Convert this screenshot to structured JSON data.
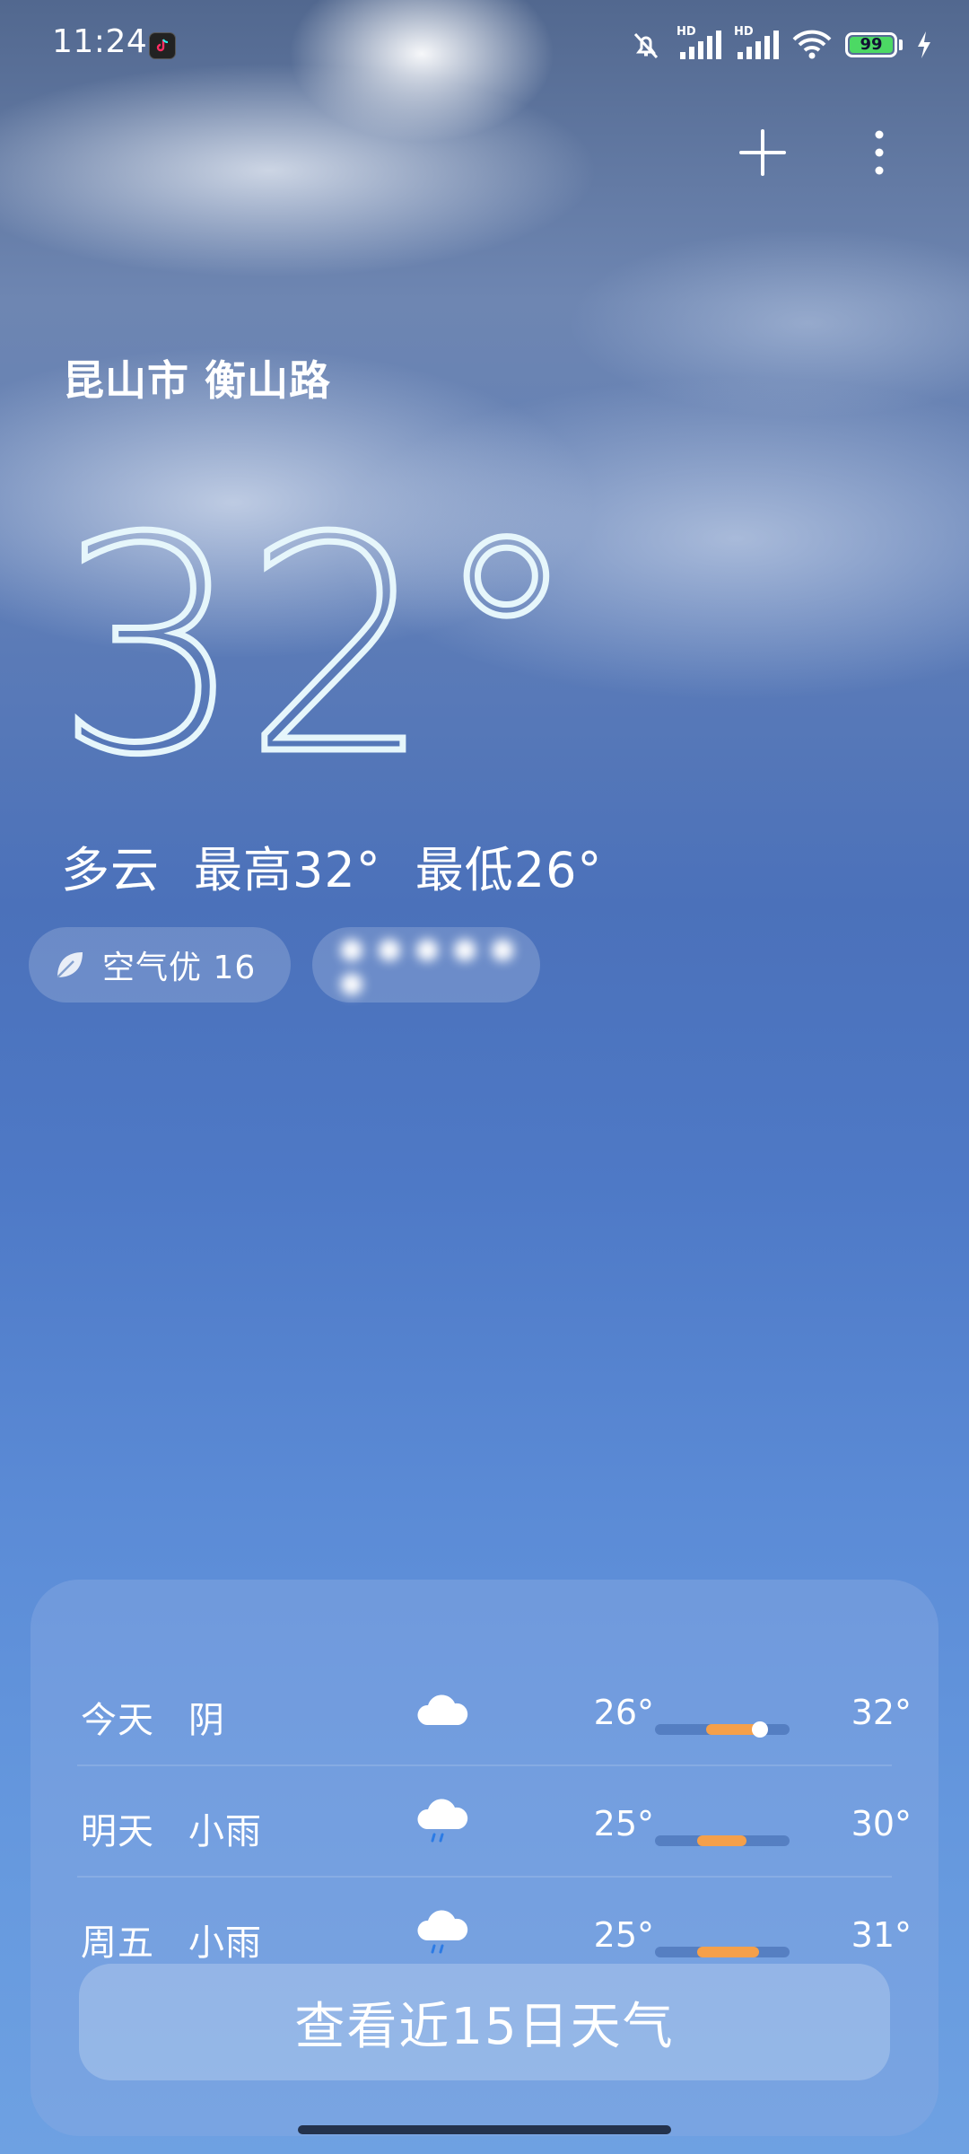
{
  "status_bar": {
    "time": "11:24",
    "battery": "99",
    "signal_labels": [
      "HD",
      "HD"
    ]
  },
  "location": "昆山市 衡山路",
  "current": {
    "temperature": "32°",
    "condition": "多云",
    "high": "最高32°",
    "low": "最低26°"
  },
  "aqi_chip": {
    "label": "空气优 16"
  },
  "forecast": [
    {
      "day": "今天",
      "condition": "阴",
      "icon": "cloud-icon",
      "low": "26°",
      "high": "32°",
      "range_start": 0.38,
      "range_end": 0.78,
      "current_marker": 0.78
    },
    {
      "day": "明天",
      "condition": "小雨",
      "icon": "rain-cloud-icon",
      "low": "25°",
      "high": "30°",
      "range_start": 0.31,
      "range_end": 0.68
    },
    {
      "day": "周五",
      "condition": "小雨",
      "icon": "rain-cloud-icon",
      "low": "25°",
      "high": "31°",
      "range_start": 0.31,
      "range_end": 0.77
    }
  ],
  "cta_label": "查看近15日天气",
  "colors": {
    "range_fill": "#f5a04a",
    "battery_fill": "#4cd964"
  }
}
